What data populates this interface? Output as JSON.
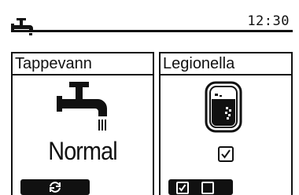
{
  "status_bar": {
    "icon": "faucet-icon",
    "time": "12:30"
  },
  "panels": [
    {
      "title": "Tappevann",
      "icon": "faucet-icon",
      "status": "Normal",
      "footer_icon": "cycle-arrows-icon"
    },
    {
      "title": "Legionella",
      "icon": "water-tank-icon",
      "checkbox_checked": true,
      "footer_controls": [
        {
          "icon": "checkbox-checked-icon",
          "checked": true
        },
        {
          "icon": "checkbox-empty-icon",
          "checked": false
        }
      ]
    }
  ],
  "colors": {
    "foreground": "#111111",
    "background": "#ffffff"
  }
}
